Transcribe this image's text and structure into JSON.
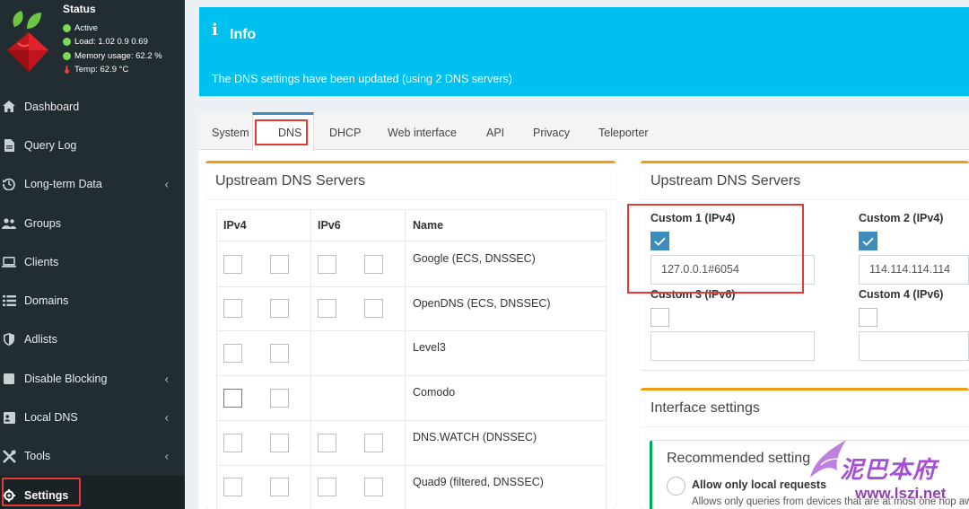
{
  "status": {
    "title": "Status",
    "active": "Active",
    "load": "Load:  1.02  0.9  0.69",
    "memory": "Memory usage:  62.2 %",
    "temp": "Temp: 62.9 °C",
    "dot_color": "#7ed957"
  },
  "sidebar": {
    "items": [
      {
        "label": "Dashboard",
        "icon": "home-icon",
        "chevron": false
      },
      {
        "label": "Query Log",
        "icon": "file-icon",
        "chevron": false
      },
      {
        "label": "Long-term Data",
        "icon": "history-icon",
        "chevron": true
      },
      {
        "label": "Groups",
        "icon": "users-icon",
        "chevron": false
      },
      {
        "label": "Clients",
        "icon": "laptop-icon",
        "chevron": false
      },
      {
        "label": "Domains",
        "icon": "list-icon",
        "chevron": false
      },
      {
        "label": "Adlists",
        "icon": "shield-icon",
        "chevron": false
      },
      {
        "label": "Disable Blocking",
        "icon": "stop-icon",
        "chevron": true
      },
      {
        "label": "Local DNS",
        "icon": "address-card-icon",
        "chevron": true
      },
      {
        "label": "Tools",
        "icon": "tools-icon",
        "chevron": true
      },
      {
        "label": "Settings",
        "icon": "gear-icon",
        "chevron": false
      }
    ],
    "chevron_glyph": "‹"
  },
  "info": {
    "icon": "i",
    "title": "Info",
    "message": "The DNS settings have been updated (using 2 DNS servers)"
  },
  "tabs": [
    "System",
    "DNS",
    "DHCP",
    "Web interface",
    "API",
    "Privacy",
    "Teleporter"
  ],
  "upstream_left": {
    "title": "Upstream DNS Servers",
    "headers": {
      "ipv4": "IPv4",
      "ipv6": "IPv6",
      "name": "Name"
    },
    "rows": [
      {
        "name": "Google (ECS, DNSSEC)"
      },
      {
        "name": "OpenDNS (ECS, DNSSEC)"
      },
      {
        "name": "Level3"
      },
      {
        "name": "Comodo"
      },
      {
        "name": "DNS.WATCH (DNSSEC)"
      },
      {
        "name": "Quad9 (filtered, DNSSEC)"
      }
    ]
  },
  "upstream_right": {
    "title": "Upstream DNS Servers",
    "custom1_label": "Custom 1 (IPv4)",
    "custom1_value": "127.0.0.1#6054",
    "custom2_label": "Custom 2 (IPv4)",
    "custom2_value": "114.114.114.114",
    "custom3_label": "Custom 3 (IPv6)",
    "custom4_label": "Custom 4 (IPv6)"
  },
  "interface": {
    "title": "Interface settings",
    "recommended_title": "Recommended setting",
    "option_label": "Allow only local requests",
    "option_desc": "Allows only queries from devices that are at most one hop away"
  },
  "watermark": {
    "text": "泥巴本府",
    "url": "www.lszi.net"
  },
  "colors": {
    "sidebar_bg": "#222d32",
    "info_bg": "#00c0ef",
    "accent": "#3c8dbc",
    "box_border": "#f39c12",
    "highlight": "#e53935",
    "recommended_border": "#00a65a"
  }
}
